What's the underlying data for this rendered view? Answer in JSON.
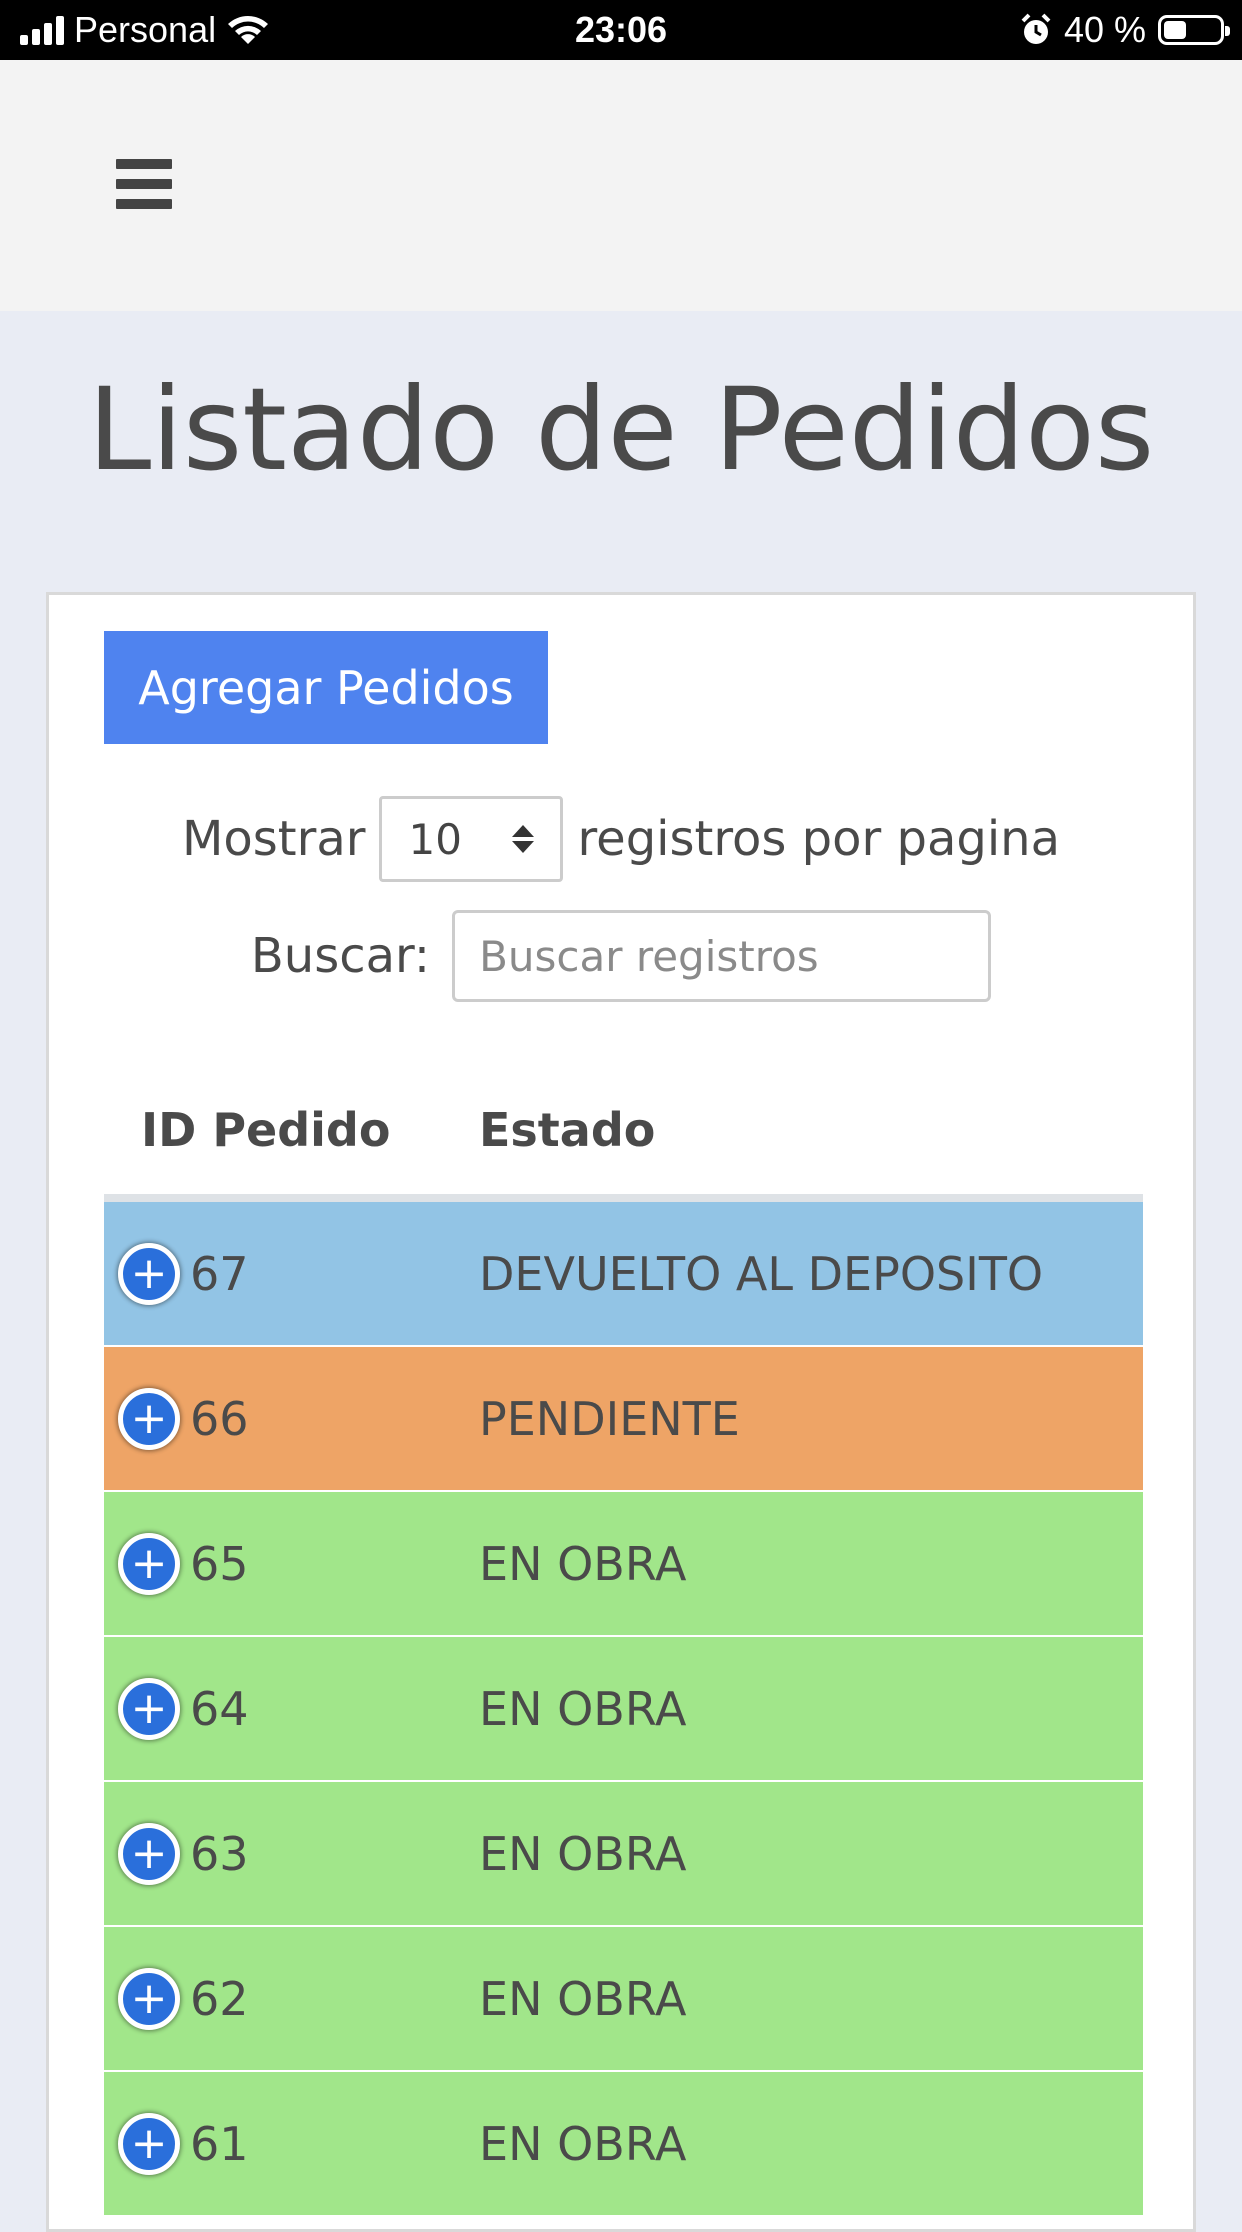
{
  "status_bar": {
    "carrier": "Personal",
    "time": "23:06",
    "battery": "40 %",
    "battery_level": 0.4,
    "icons": [
      "signal-icon",
      "wifi-icon",
      "alarm-icon",
      "battery-icon"
    ]
  },
  "navbar": {
    "menu_icon": "hamburger-menu-icon"
  },
  "page": {
    "title": "Listado de Pedidos"
  },
  "card": {
    "add_button_label": "Agregar Pedidos",
    "length": {
      "prefix": "Mostrar",
      "selected": "10",
      "suffix": "registros por pagina"
    },
    "search": {
      "label": "Buscar:",
      "placeholder": "Buscar registros",
      "value": ""
    }
  },
  "table": {
    "columns": [
      "ID Pedido",
      "Estado"
    ],
    "rows": [
      {
        "id": "67",
        "estado": "DEVUELTO AL DEPOSITO",
        "color": "#92c4e5"
      },
      {
        "id": "66",
        "estado": "PENDIENTE",
        "color": "#eea466"
      },
      {
        "id": "65",
        "estado": "EN OBRA",
        "color": "#a1e68a"
      },
      {
        "id": "64",
        "estado": "EN OBRA",
        "color": "#a1e68a"
      },
      {
        "id": "63",
        "estado": "EN OBRA",
        "color": "#a1e68a"
      },
      {
        "id": "62",
        "estado": "EN OBRA",
        "color": "#a1e68a"
      },
      {
        "id": "61",
        "estado": "EN OBRA",
        "color": "#a1e68a"
      }
    ]
  },
  "colors": {
    "accent_button": "#4f83ef",
    "expand_icon": "#2a6fdb",
    "page_background": "#e9ecf4",
    "navbar_background": "#f3f3f3"
  }
}
